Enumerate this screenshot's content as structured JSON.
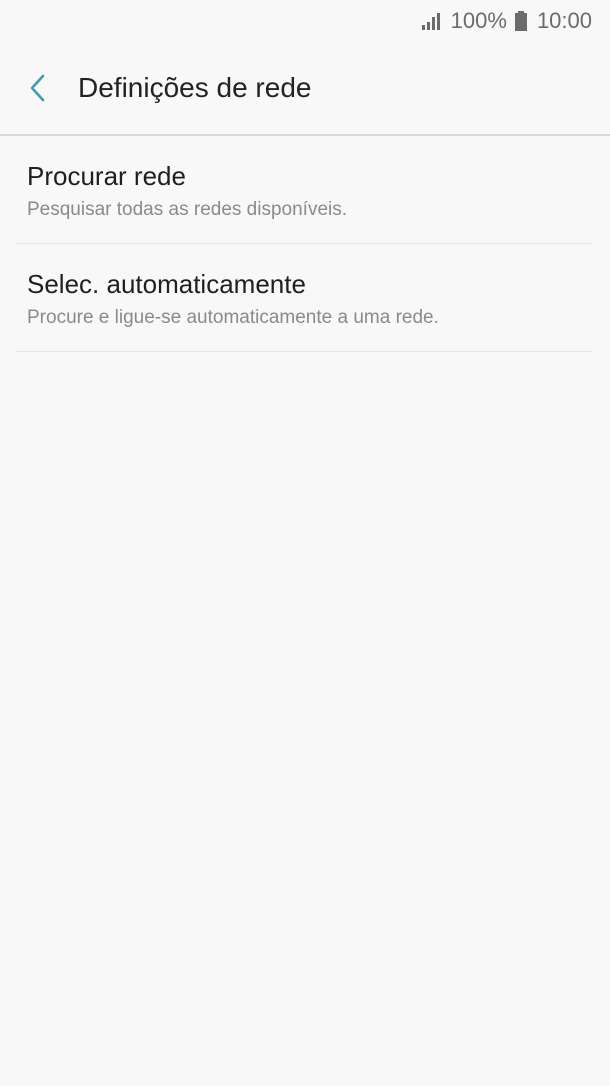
{
  "status_bar": {
    "battery": "100%",
    "time": "10:00",
    "signal_icon": "signal-icon",
    "battery_icon": "battery-icon"
  },
  "app_bar": {
    "back_icon": "back-chevron-icon",
    "title": "Definições de rede",
    "accent_color": "#3f9bb0"
  },
  "items": [
    {
      "title": "Procurar rede",
      "subtitle": "Pesquisar todas as redes disponíveis."
    },
    {
      "title": "Selec. automaticamente",
      "subtitle": "Procure e ligue-se automaticamente a uma rede."
    }
  ]
}
